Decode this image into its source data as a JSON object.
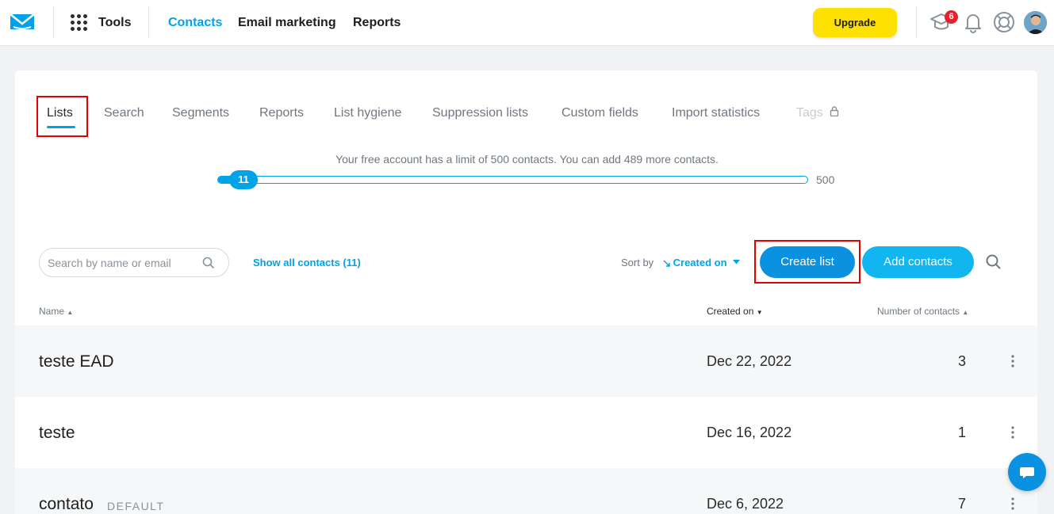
{
  "topbar": {
    "tools_label": "Tools",
    "nav": [
      "Contacts",
      "Email marketing",
      "Reports"
    ],
    "upgrade_label": "Upgrade",
    "notification_count": "6"
  },
  "tabs": [
    "Lists",
    "Search",
    "Segments",
    "Reports",
    "List hygiene",
    "Suppression lists",
    "Custom fields",
    "Import statistics",
    "Tags"
  ],
  "limit": {
    "text": "Your free account has a limit of 500 contacts. You can add 489 more contacts.",
    "current": "11",
    "max": "500",
    "fraction": 0.022
  },
  "toolbar": {
    "search_placeholder": "Search by name or email",
    "show_all": "Show all contacts (11)",
    "sort_by": "Sort by",
    "sort_value": "Created on",
    "create_list": "Create list",
    "add_contacts": "Add contacts"
  },
  "table": {
    "headers": [
      "Name",
      "Created on",
      "Number of contacts"
    ],
    "rows": [
      {
        "name": "teste EAD",
        "tag": "",
        "date": "Dec 22, 2022",
        "count": "3"
      },
      {
        "name": "teste",
        "tag": "",
        "date": "Dec 16, 2022",
        "count": "1"
      },
      {
        "name": "contato",
        "tag": "DEFAULT",
        "date": "Dec 6, 2022",
        "count": "7"
      }
    ]
  },
  "colors": {
    "accent": "#00a2e8",
    "upgrade": "#ffe100",
    "highlight": "#e60000"
  }
}
